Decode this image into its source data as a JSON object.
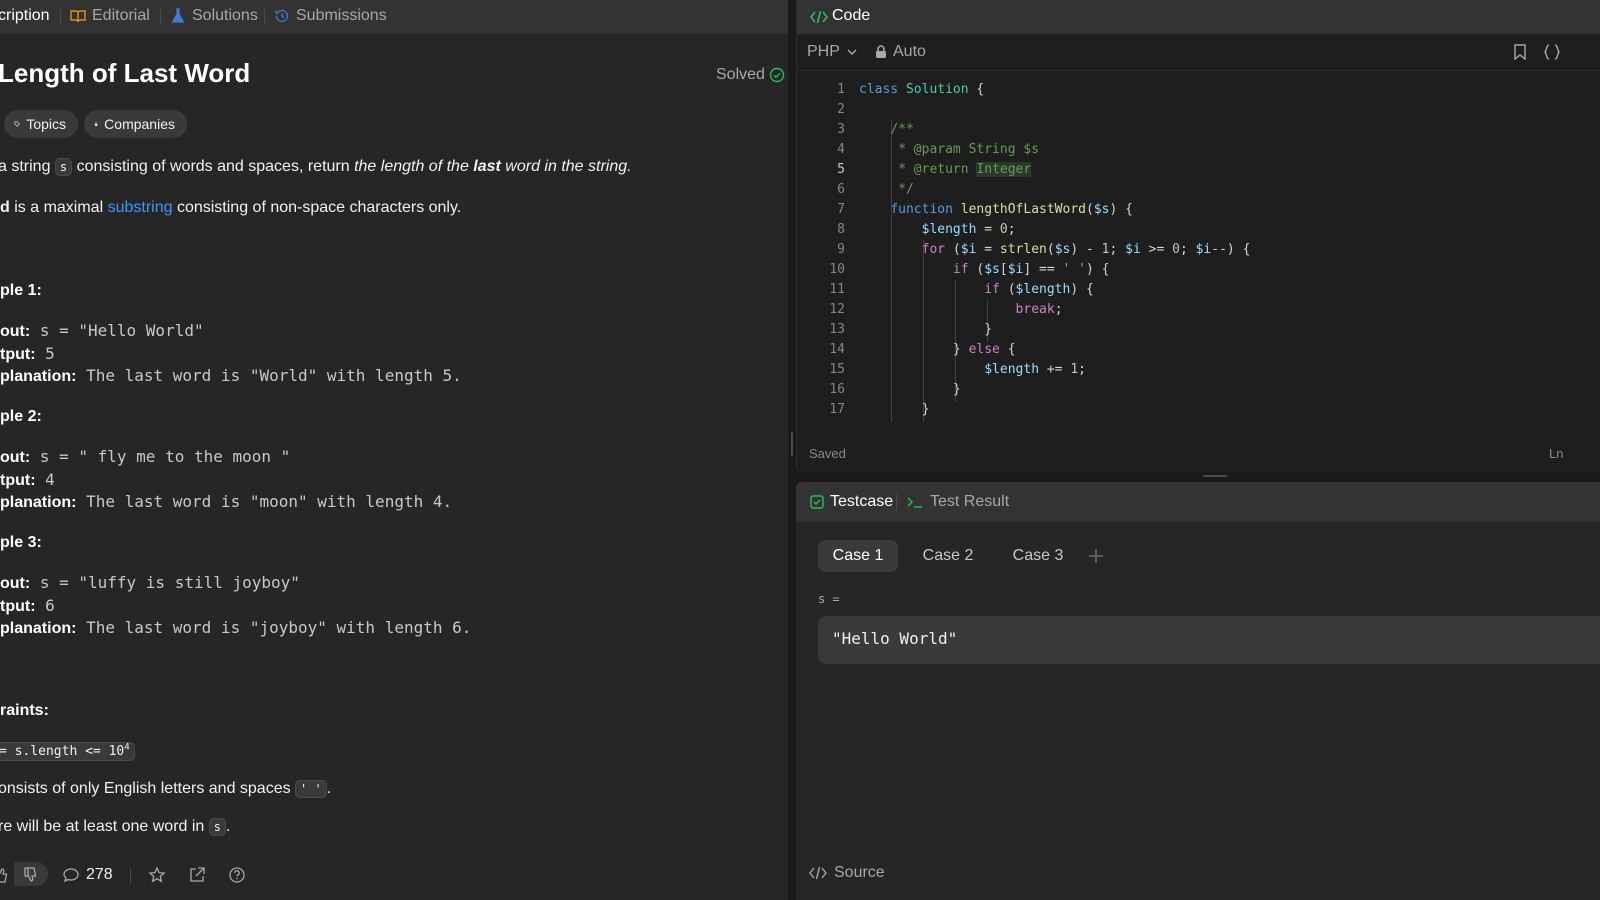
{
  "left_tabs": [
    {
      "label": "cription",
      "icon": "description-icon"
    },
    {
      "label": "Editorial",
      "icon": "book-icon"
    },
    {
      "label": "Solutions",
      "icon": "flask-icon"
    },
    {
      "label": "Submissions",
      "icon": "history-icon"
    }
  ],
  "problem": {
    "title": "Length of Last Word",
    "solved_label": "Solved",
    "topics_label": "Topics",
    "companies_label": "Companies",
    "desc1_a": "a string ",
    "desc1_code": "s",
    "desc1_b": " consisting of words and spaces, return ",
    "desc1_c": "the length of the ",
    "desc1_d": "last",
    "desc1_e": " word in the string.",
    "desc2_a": "d",
    "desc2_b": " is a maximal ",
    "desc2_link": "substring",
    "desc2_c": " consisting of non-space characters only."
  },
  "examples": [
    {
      "heading": "ple 1:",
      "input_label": "out:",
      "input": " s = \"Hello World\"",
      "output_label": "tput:",
      "output": " 5",
      "expl_label": "planation:",
      "expl": " The last word is \"World\" with length 5."
    },
    {
      "heading": "ple 2:",
      "input_label": "out:",
      "input": " s = \"   fly me   to   the moon  \"",
      "output_label": "tput:",
      "output": " 4",
      "expl_label": "planation:",
      "expl": " The last word is \"moon\" with length 4."
    },
    {
      "heading": "ple 3:",
      "input_label": "out:",
      "input": " s = \"luffy is still joyboy\"",
      "output_label": "tput:",
      "output": " 6",
      "expl_label": "planation:",
      "expl": " The last word is \"joyboy\" with length 6."
    }
  ],
  "constraints": {
    "heading": "raints:",
    "c1_code": "= s.length <= 10",
    "c1_sup": "4",
    "c2_text": "onsists of only English letters and spaces ",
    "c2_code": "' '",
    "c2_end": ".",
    "c3_text": "re will be at least one word in ",
    "c3_code": "s",
    "c3_end": "."
  },
  "left_footer": {
    "comments_count": "278"
  },
  "code_panel": {
    "title": "Code",
    "language": "PHP",
    "mode": "Auto",
    "status": "Saved",
    "status_right": "Ln",
    "line_numbers": [
      "1",
      "2",
      "3",
      "4",
      "5",
      "6",
      "7",
      "8",
      "9",
      "10",
      "11",
      "12",
      "13",
      "14",
      "15",
      "16",
      "17"
    ]
  },
  "test_panel": {
    "testcase_label": "Testcase",
    "result_label": "Test Result",
    "cases": [
      "Case 1",
      "Case 2",
      "Case 3"
    ],
    "param_label": "s =",
    "param_value": "\"Hello World\"",
    "source_label": "Source"
  },
  "colors": {
    "accent_green": "#2cbb5d",
    "link_blue": "#3c96ff",
    "bg_dark": "#1a1a1a",
    "panel": "#262626"
  }
}
